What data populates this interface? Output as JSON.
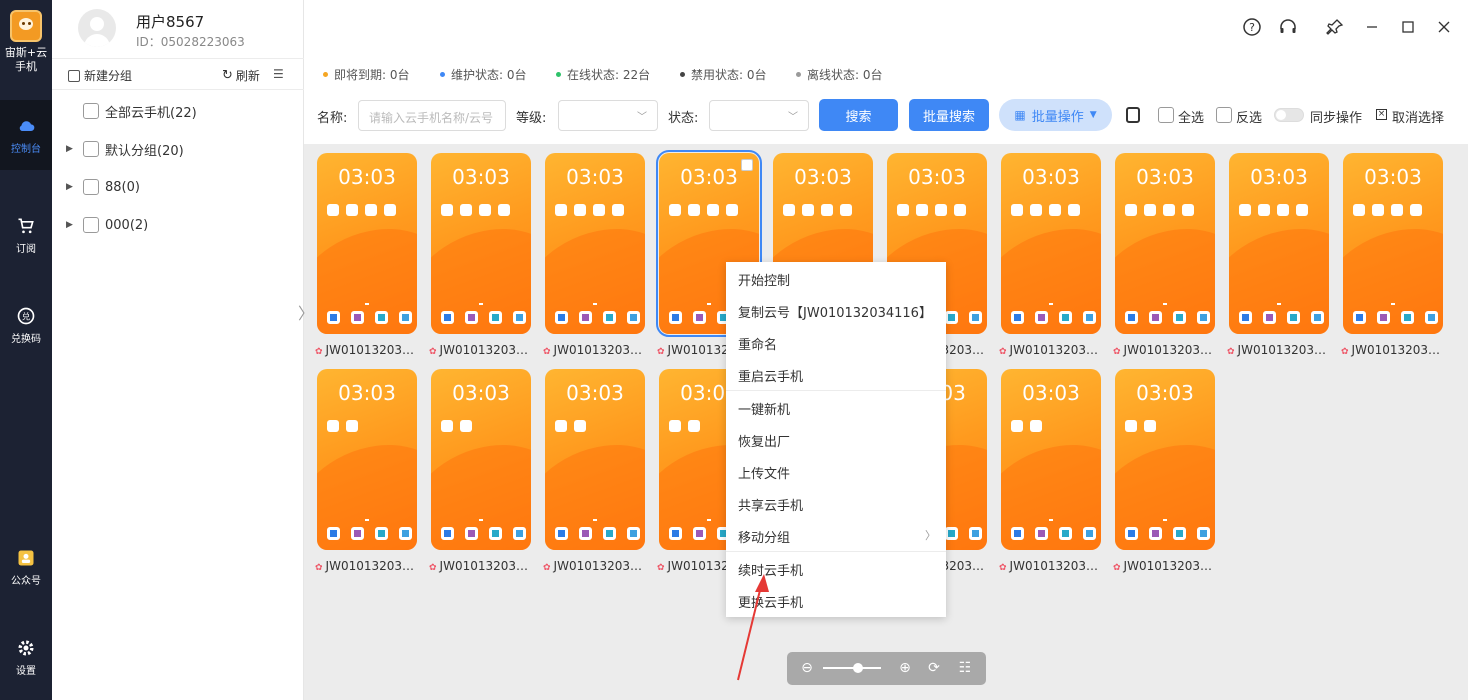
{
  "app": {
    "logo_text_line1": "宙斯+云",
    "logo_text_line2": "手机"
  },
  "nav": {
    "items": [
      {
        "label": "控制台",
        "icon": "cloud-icon",
        "active": true
      },
      {
        "label": "订阅",
        "icon": "cart-icon",
        "active": false
      },
      {
        "label": "兑换码",
        "icon": "exchange-icon",
        "active": false
      },
      {
        "label": "公众号",
        "icon": "account-icon",
        "active": false
      },
      {
        "label": "设置",
        "icon": "gear-icon",
        "active": false
      }
    ]
  },
  "profile": {
    "username": "用户8567",
    "id": "ID：05028223063"
  },
  "sidebar": {
    "new_group": "新建分组",
    "refresh": "刷新",
    "groups": [
      {
        "label": "全部云手机(22)",
        "expandable": false
      },
      {
        "label": "默认分组(20)",
        "expandable": true
      },
      {
        "label": "88(0)",
        "expandable": true
      },
      {
        "label": "000(2)",
        "expandable": true
      }
    ]
  },
  "status": [
    {
      "label": "即将到期: 0台",
      "color": "#f5a623"
    },
    {
      "label": "维护状态: 0台",
      "color": "#3f88f5"
    },
    {
      "label": "在线状态: 22台",
      "color": "#2ec26a"
    },
    {
      "label": "禁用状态: 0台",
      "color": "#444444"
    },
    {
      "label": "离线状态: 0台",
      "color": "#9a9a9a"
    }
  ],
  "filters": {
    "name_label": "名称:",
    "name_placeholder": "请输入云手机名称/云号",
    "level_label": "等级:",
    "state_label": "状态:",
    "search_button": "搜索",
    "batch_search_button": "批量搜索",
    "batch_ops_button": "批量操作",
    "select_all": "全选",
    "invert": "反选",
    "sync": "同步操作",
    "cancel_select": "取消选择"
  },
  "phones": {
    "time": "03:03",
    "names": [
      "JW01013203…",
      "JW01013203…",
      "JW01013203…",
      "JW01013203…",
      "JW01013203…",
      "JW01013203…",
      "JW01013203…",
      "JW01013203…",
      "JW01013203…",
      "JW01013203…",
      "JW01013203…",
      "JW01013203…",
      "JW01013203…",
      "JW01013203…",
      "JW01013203…",
      "JW01013203…",
      "JW01013203…",
      "JW01013203…"
    ]
  },
  "context_menu": {
    "items": [
      "开始控制",
      "复制云号【JW010132034116】",
      "重命名",
      "重启云手机",
      "一键新机",
      "恢复出厂",
      "上传文件",
      "共享云手机",
      "移动分组",
      "续时云手机",
      "更换云手机"
    ]
  },
  "colors": {
    "accent": "#3f88f5",
    "nav_bg": "#1c2233",
    "annotation_arrow": "#e53935"
  }
}
